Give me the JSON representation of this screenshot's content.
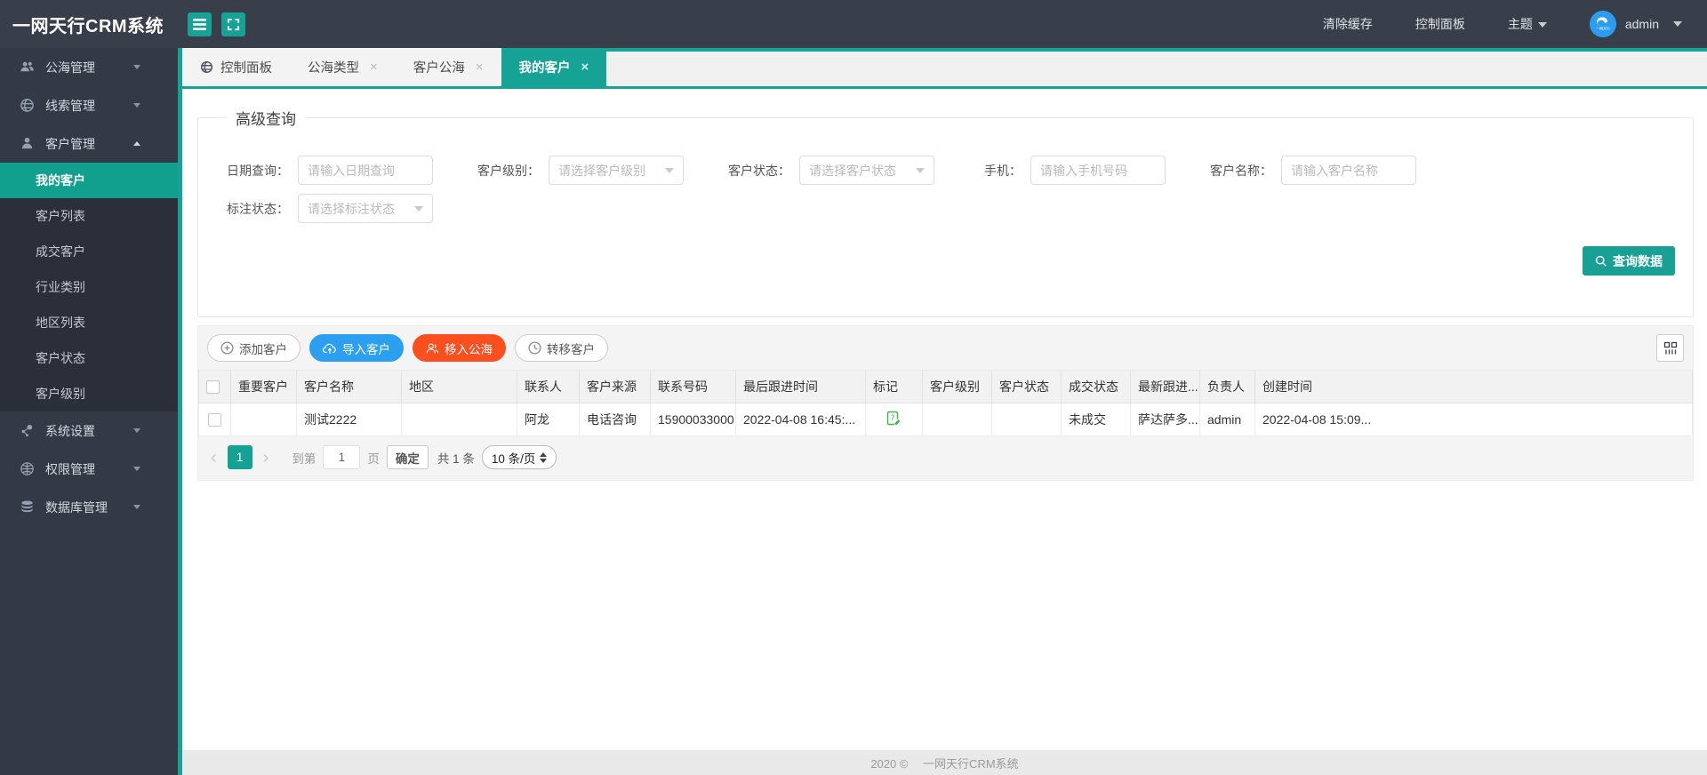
{
  "accent_color": "#17a296",
  "header": {
    "brand": "一网天行CRM系统",
    "clear_cache": "清除缓存",
    "control_panel": "控制面板",
    "theme": "主题",
    "username": "admin"
  },
  "sidebar": {
    "items": [
      {
        "label": "公海管理",
        "icon": "users-icon",
        "state": "collapsed"
      },
      {
        "label": "线索管理",
        "icon": "globe-icon",
        "state": "collapsed"
      },
      {
        "label": "客户管理",
        "icon": "user-icon",
        "state": "expanded",
        "children": [
          "我的客户",
          "客户列表",
          "成交客户",
          "行业类别",
          "地区列表",
          "客户状态",
          "客户级别"
        ],
        "active_child": "我的客户"
      },
      {
        "label": "系统设置",
        "icon": "nodes-icon",
        "state": "collapsed"
      },
      {
        "label": "权限管理",
        "icon": "globe-grid-icon",
        "state": "collapsed"
      },
      {
        "label": "数据库管理",
        "icon": "database-icon",
        "state": "collapsed"
      }
    ]
  },
  "tabs": {
    "items": [
      {
        "label": "控制面板",
        "closable": false,
        "active": false
      },
      {
        "label": "公海类型",
        "closable": true,
        "active": false
      },
      {
        "label": "客户公海",
        "closable": true,
        "active": false
      },
      {
        "label": "我的客户",
        "closable": true,
        "active": true
      }
    ]
  },
  "search": {
    "legend": "高级查询",
    "fields": [
      {
        "label": "日期查询：",
        "type": "input",
        "placeholder": "请输入日期查询"
      },
      {
        "label": "客户级别：",
        "type": "select",
        "placeholder": "请选择客户级别"
      },
      {
        "label": "客户状态：",
        "type": "select",
        "placeholder": "请选择客户状态"
      },
      {
        "label": "手机：",
        "type": "input",
        "placeholder": "请输入手机号码"
      },
      {
        "label": "客户名称：",
        "type": "input",
        "placeholder": "请输入客户名称"
      },
      {
        "label": "标注状态：",
        "type": "select",
        "placeholder": "请选择标注状态"
      }
    ],
    "submit_label": "查询数据"
  },
  "toolbar": {
    "add": "添加客户",
    "import": "导入客户",
    "move_to_sea": "移入公海",
    "transfer": "转移客户"
  },
  "table": {
    "columns": [
      "重要客户",
      "客户名称",
      "地区",
      "联系人",
      "客户来源",
      "联系号码",
      "最后跟进时间",
      "标记",
      "客户级别",
      "客户状态",
      "成交状态",
      "最新跟进...",
      "负责人",
      "创建时间"
    ],
    "rows": [
      {
        "important": "",
        "name": "测试2222",
        "region": "",
        "contact": "阿龙",
        "source": "电话咨询",
        "phone": "15900033000",
        "last_follow": "2022-04-08 16:45:...",
        "mark_icon": "note-edit-icon",
        "level": "",
        "status": "",
        "deal_status": "未成交",
        "latest_follow": "萨达萨多...",
        "owner": "admin",
        "created": "2022-04-08 15:09..."
      }
    ]
  },
  "pagination": {
    "current_page": "1",
    "goto_prefix": "到第",
    "goto_value": "1",
    "goto_suffix": "页",
    "confirm_label": "确定",
    "total_text": "共 1 条",
    "page_size": "10 条/页"
  },
  "footer": {
    "copyright": "2020 ©　 一网天行CRM系统"
  }
}
